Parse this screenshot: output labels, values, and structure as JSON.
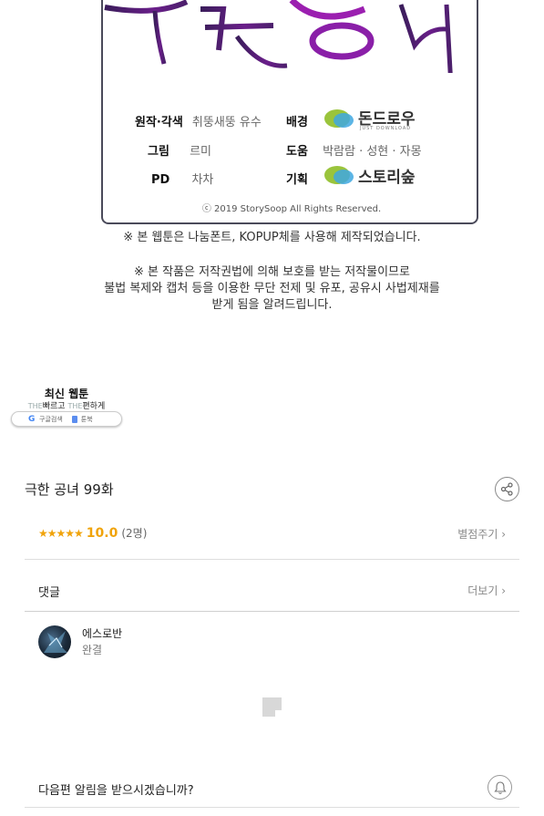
{
  "artwork": {
    "title_text": "극한 공녀",
    "credits": {
      "original": {
        "label": "원작·각색",
        "value": "취뚱새뚱 유수"
      },
      "background": {
        "label": "배경",
        "brand": "돈드로우",
        "brand_sub": "JUST DOWNLOAD"
      },
      "art": {
        "label": "그림",
        "value": "르미"
      },
      "assist": {
        "label": "도움",
        "value": "박람람 · 성현 · 자몽"
      },
      "pd": {
        "label": "PD",
        "value": "차차"
      },
      "planning": {
        "label": "기획",
        "brand": "스토리숲"
      },
      "copyright": "ⓒ 2019 StorySoop All Rights Reserved."
    },
    "font_notice": "※ 본 웹툰은 나눔폰트, KOPUP체를 사용해 제작되었습니다.",
    "legal_notice": [
      "※ 본 작품은 저작권법에 의해 보호를 받는 저작물이므로",
      "불법 복제와 캡처 등을 이용한 무단 전제 및 유포, 공유시 사법제재를",
      "받게 됨을 알려드립니다."
    ]
  },
  "banner": {
    "title": "최신 웹툰",
    "the1": "THE",
    "fast": "빠르고",
    "the2": "THE",
    "easy": "편하게",
    "pill_search": "구글검색",
    "pill_site": "툰북"
  },
  "episode": {
    "title": "극한 공녀 99화",
    "stars": "★★★★★",
    "score": "10.0",
    "count": "(2명)",
    "rate_link": "별점주기 ›"
  },
  "comments": {
    "heading": "댓글",
    "more_link": "더보기 ›",
    "items": [
      {
        "author": "에스로반",
        "text": "완결"
      }
    ]
  },
  "notify": {
    "question": "다음편 알림을 받으시겠습니까?"
  },
  "colors": {
    "rating": "#f0a30a",
    "title_purple": "#4b1f6b",
    "title_magenta": "#9b1fb0",
    "logo_blue": "#3fa8e0",
    "logo_green": "#9ac43c"
  }
}
